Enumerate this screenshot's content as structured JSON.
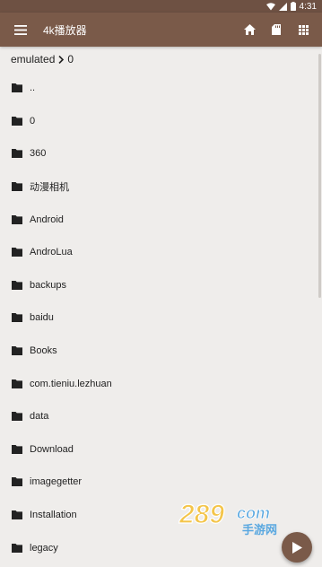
{
  "status": {
    "time": "4:31"
  },
  "app": {
    "title": "4k播放器"
  },
  "icons": {
    "menu": "hamburger-menu-icon",
    "home": "home-icon",
    "sd": "sd-card-icon",
    "grid": "grid-icon",
    "folder": "folder-icon",
    "play": "play-icon",
    "chevron": "chevron-right-icon"
  },
  "colors": {
    "app_bar": "#7a5a49",
    "status_bar": "#6e5143",
    "background": "#efedeb"
  },
  "breadcrumb": {
    "root": "emulated",
    "current": "0"
  },
  "files": [
    {
      "label": ".."
    },
    {
      "label": "0"
    },
    {
      "label": "360"
    },
    {
      "label": "动漫相机"
    },
    {
      "label": "Android"
    },
    {
      "label": "AndroLua"
    },
    {
      "label": "backups"
    },
    {
      "label": "baidu"
    },
    {
      "label": "Books"
    },
    {
      "label": "com.tieniu.lezhuan"
    },
    {
      "label": "data"
    },
    {
      "label": "Download"
    },
    {
      "label": "imagegetter"
    },
    {
      "label": "Installation"
    },
    {
      "label": "legacy"
    }
  ],
  "watermark": {
    "brand": "289",
    "suffix": "com",
    "subtitle": "手游网"
  }
}
